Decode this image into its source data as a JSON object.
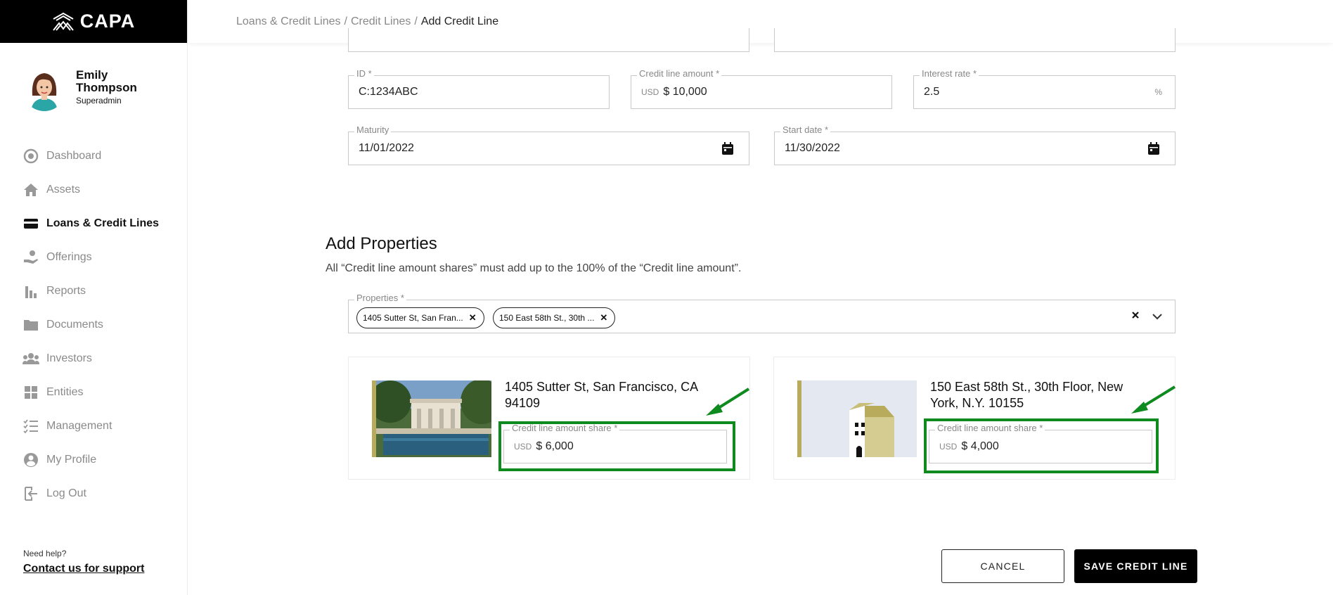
{
  "app": {
    "logo_text": "CAPA"
  },
  "user": {
    "name": "Emily Thompson",
    "role": "Superadmin"
  },
  "nav": [
    {
      "label": "Dashboard",
      "icon": "dashboard-icon",
      "active": false
    },
    {
      "label": "Assets",
      "icon": "home-icon",
      "active": false
    },
    {
      "label": "Loans & Credit Lines",
      "icon": "credit-card-icon",
      "active": true
    },
    {
      "label": "Offerings",
      "icon": "hand-coin-icon",
      "active": false
    },
    {
      "label": "Reports",
      "icon": "bar-chart-icon",
      "active": false
    },
    {
      "label": "Documents",
      "icon": "folder-icon",
      "active": false
    },
    {
      "label": "Investors",
      "icon": "people-icon",
      "active": false
    },
    {
      "label": "Entities",
      "icon": "grid-icon",
      "active": false
    },
    {
      "label": "Management",
      "icon": "checklist-icon",
      "active": false
    },
    {
      "label": "My Profile",
      "icon": "profile-icon",
      "active": false
    },
    {
      "label": "Log Out",
      "icon": "logout-icon",
      "active": false
    }
  ],
  "help": {
    "text": "Need help?",
    "link": "Contact us for support"
  },
  "breadcrumb": {
    "items": [
      "Loans & Credit Lines",
      "Credit Lines"
    ],
    "current": "Add Credit Line",
    "separator": "/"
  },
  "form": {
    "id": {
      "label": "ID *",
      "value": "C:1234ABC"
    },
    "amount": {
      "label": "Credit line amount *",
      "currency": "USD",
      "value": "$ 10,000"
    },
    "rate": {
      "label": "Interest rate *",
      "value": "2.5",
      "suffix": "%"
    },
    "maturity": {
      "label": "Maturity",
      "value": "11/01/2022"
    },
    "start": {
      "label": "Start date *",
      "value": "11/30/2022"
    }
  },
  "properties": {
    "title": "Add Properties",
    "note": "All “Credit line amount shares” must add up to the 100% of the “Credit line amount”.",
    "select_label": "Properties *",
    "chips": [
      "1405 Sutter St, San Fran...",
      "150 East 58th St., 30th ..."
    ],
    "cards": [
      {
        "address": "1405 Sutter St, San Francisco, CA 94109",
        "share_label": "Credit line amount share *",
        "currency": "USD",
        "share": "$ 6,000"
      },
      {
        "address": "150 East 58th St., 30th Floor, New York, N.Y. 10155",
        "share_label": "Credit line amount share *",
        "currency": "USD",
        "share": "$ 4,000"
      }
    ]
  },
  "actions": {
    "cancel": "CANCEL",
    "save": "SAVE CREDIT LINE"
  },
  "colors": {
    "accent": "#b8ac5c",
    "highlight": "#0e8a1e",
    "black": "#000000"
  }
}
